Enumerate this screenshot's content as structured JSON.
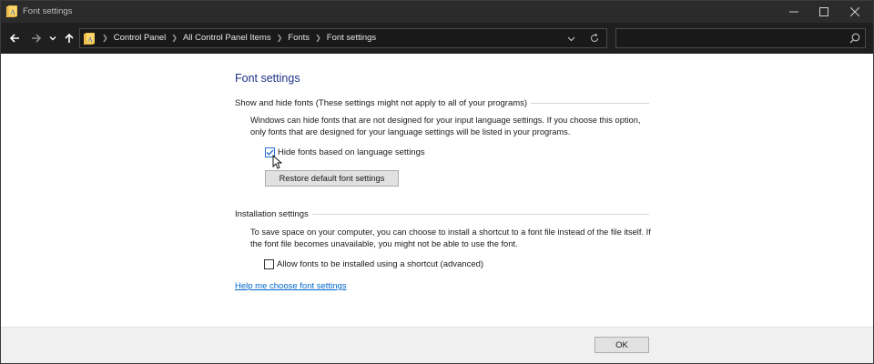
{
  "window": {
    "title": "Font settings",
    "controls": {
      "minimize": "—",
      "maximize": "☐",
      "close": "✕"
    }
  },
  "navigation": {
    "breadcrumbs": [
      "Control Panel",
      "All Control Panel Items",
      "Fonts",
      "Font settings"
    ],
    "search_placeholder": ""
  },
  "page": {
    "title": "Font settings",
    "show_hide_group": {
      "header": "Show and hide fonts (These settings might not apply to all of your programs)",
      "description": "Windows can hide fonts that are not designed for your input language settings. If you choose this option, only fonts that are designed for your language settings will be listed in your programs.",
      "checkbox_label": "Hide fonts based on language settings",
      "checkbox_checked": true,
      "restore_button": "Restore default font settings"
    },
    "installation_group": {
      "header": "Installation settings",
      "description": "To save space on your computer, you can choose to install a shortcut to a font file instead of the file itself. If the font file becomes unavailable, you might not be able to use the font.",
      "checkbox_label": "Allow fonts to be installed using a shortcut (advanced)",
      "checkbox_checked": false
    },
    "help_link": "Help me choose font settings"
  },
  "footer": {
    "ok_button": "OK"
  },
  "colors": {
    "titlebar": "#2b2b2b",
    "navbar": "#1f1f1f",
    "page_title": "#1e3287",
    "link": "#0066cc",
    "checkbox_accent": "#2a6fcf"
  },
  "icons": {
    "app": "folder-font-icon",
    "back": "arrow-left-icon",
    "forward": "arrow-right-icon",
    "recent": "chevron-down-icon",
    "up": "arrow-up-icon",
    "address_dropdown": "chevron-down-icon",
    "refresh": "refresh-icon",
    "search": "search-icon"
  }
}
